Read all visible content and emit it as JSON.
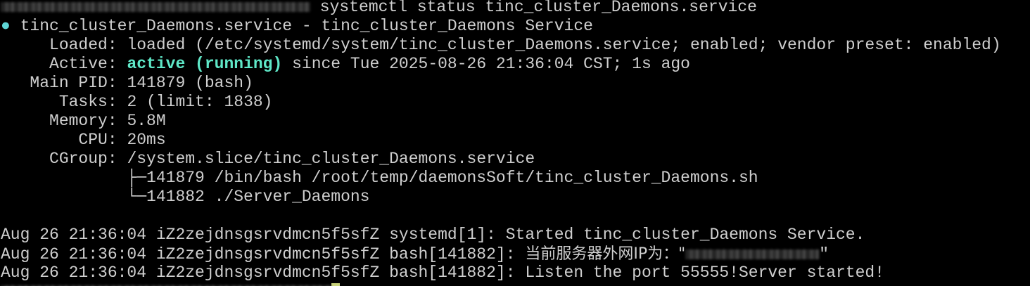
{
  "window": {
    "prompt_command": " systemctl status tinc_cluster_Daemons.service"
  },
  "status": {
    "bullet": "●",
    "header": " tinc_cluster_Daemons.service - tinc_cluster_Daemons Service",
    "loaded_label": "     Loaded: ",
    "loaded_value": "loaded (/etc/systemd/system/tinc_cluster_Daemons.service; enabled; vendor preset: enabled)",
    "active_label": "     Active: ",
    "active_state": "active (running)",
    "active_since": " since Tue 2025-08-26 21:36:04 CST; 1s ago",
    "main_pid_label": "   Main PID: ",
    "main_pid_value": "141879 (bash)",
    "tasks_label": "      Tasks: ",
    "tasks_value": "2 (limit: 1838)",
    "memory_label": "     Memory: ",
    "memory_value": "5.8M",
    "cpu_label": "        CPU: ",
    "cpu_value": "20ms",
    "cgroup_label": "     CGroup: ",
    "cgroup_value": "/system.slice/tinc_cluster_Daemons.service",
    "cgroup_tree": [
      "             ├─141879 /bin/bash /root/temp/daemonsSoft/tinc_cluster_Daemons.sh",
      "             └─141882 ./Server_Daemons"
    ]
  },
  "logs": [
    "Aug 26 21:36:04 iZ2zejdnsgsrvdmcn5f5sfZ systemd[1]: Started tinc_cluster_Daemons Service.",
    "Aug 26 21:36:04 iZ2zejdnsgsrvdmcn5f5sfZ bash[141882]: ",
    "Aug 26 21:36:04 iZ2zejdnsgsrvdmcn5f5sfZ bash[141882]: Listen the port 55555!Server started!"
  ],
  "log_ip_prefix": "当前服务器外网IP为：\"",
  "log_ip_suffix": "\"",
  "colors": {
    "background": "#000000",
    "text": "#cfcfcf",
    "active_green": "#5fe8c8",
    "bullet": "#5fd7d7",
    "cursor": "#c8d27a"
  }
}
